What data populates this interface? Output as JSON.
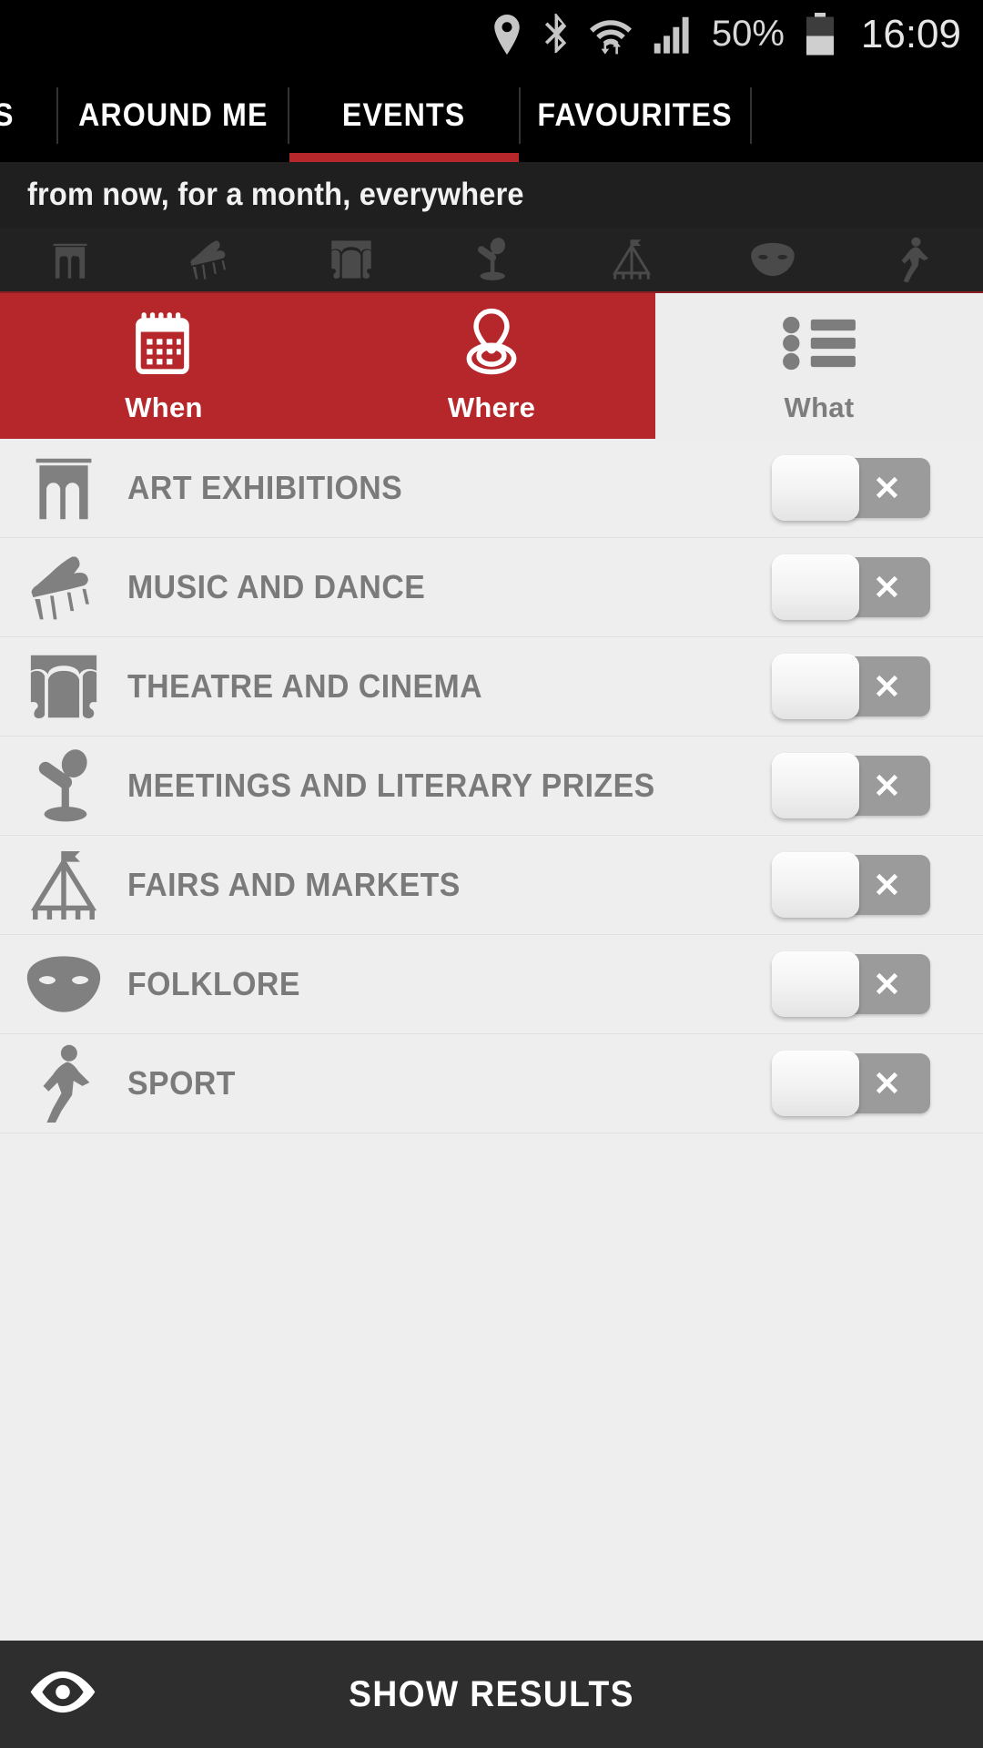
{
  "statusbar": {
    "icons": [
      "location-icon",
      "bluetooth-icon",
      "wifi-icon",
      "signal-icon"
    ],
    "battery_percent": "50%",
    "battery_icon": "battery-icon",
    "time": "16:09"
  },
  "tabs": {
    "items": [
      {
        "label": "S",
        "partial": true,
        "active": false
      },
      {
        "label": "AROUND ME",
        "partial": false,
        "active": false
      },
      {
        "label": "EVENTS",
        "partial": false,
        "active": true
      },
      {
        "label": "FAVOURITES",
        "partial": false,
        "active": false
      }
    ],
    "active_underline_color": "#b5272b"
  },
  "filter_summary": {
    "text": "from now, for a month, everywhere"
  },
  "icon_strip": {
    "icons": [
      "art-exhibitions-icon",
      "music-and-dance-icon",
      "theatre-and-cinema-icon",
      "meetings-and-literary-prizes-icon",
      "fairs-and-markets-icon",
      "folklore-icon",
      "sport-icon"
    ]
  },
  "filter_tabs": {
    "items": [
      {
        "label": "When",
        "icon": "calendar-icon",
        "active": true
      },
      {
        "label": "Where",
        "icon": "location-pin-icon",
        "active": true
      },
      {
        "label": "What",
        "icon": "list-icon",
        "active": false
      }
    ],
    "active_background": "#b5272b",
    "inactive_background": "#ededed"
  },
  "categories": {
    "rows": [
      {
        "label": "ART EXHIBITIONS",
        "icon": "art-exhibitions-icon",
        "toggle_state": "off",
        "toggle_mark": "✕"
      },
      {
        "label": "MUSIC AND DANCE",
        "icon": "music-and-dance-icon",
        "toggle_state": "off",
        "toggle_mark": "✕"
      },
      {
        "label": "THEATRE AND CINEMA",
        "icon": "theatre-and-cinema-icon",
        "toggle_state": "off",
        "toggle_mark": "✕"
      },
      {
        "label": "MEETINGS AND LITERARY PRIZES",
        "icon": "meetings-and-literary-prizes-icon",
        "toggle_state": "off",
        "toggle_mark": "✕"
      },
      {
        "label": "FAIRS AND MARKETS",
        "icon": "fairs-and-markets-icon",
        "toggle_state": "off",
        "toggle_mark": "✕"
      },
      {
        "label": "FOLKLORE",
        "icon": "folklore-icon",
        "toggle_state": "off",
        "toggle_mark": "✕"
      },
      {
        "label": "SPORT",
        "icon": "sport-icon",
        "toggle_state": "off",
        "toggle_mark": "✕"
      }
    ]
  },
  "bottom_bar": {
    "label": "SHOW RESULTS",
    "icon": "eye-icon",
    "background": "#2e2e2e"
  }
}
